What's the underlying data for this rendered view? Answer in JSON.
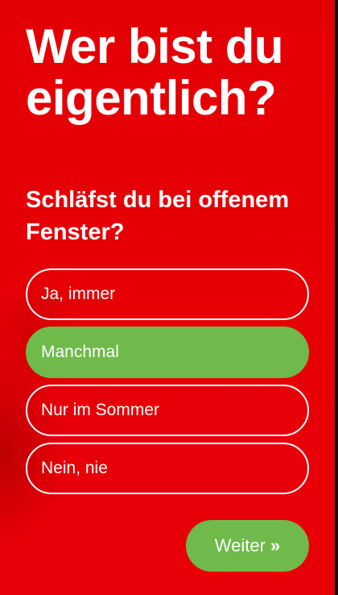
{
  "headline": "Wer bist du eigentlich?",
  "question": "Schläfst du bei offenem Fenster?",
  "options": [
    {
      "label": "Ja, immer",
      "selected": false
    },
    {
      "label": "Manchmal",
      "selected": true
    },
    {
      "label": "Nur im Sommer",
      "selected": false
    },
    {
      "label": "Nein, nie",
      "selected": false
    }
  ],
  "next_button": {
    "label": "Weiter",
    "icon": "double-chevron-right-icon",
    "glyph": "»"
  },
  "colors": {
    "background": "#e60005",
    "accent_green": "#6fba4a",
    "text": "#ffffff"
  }
}
